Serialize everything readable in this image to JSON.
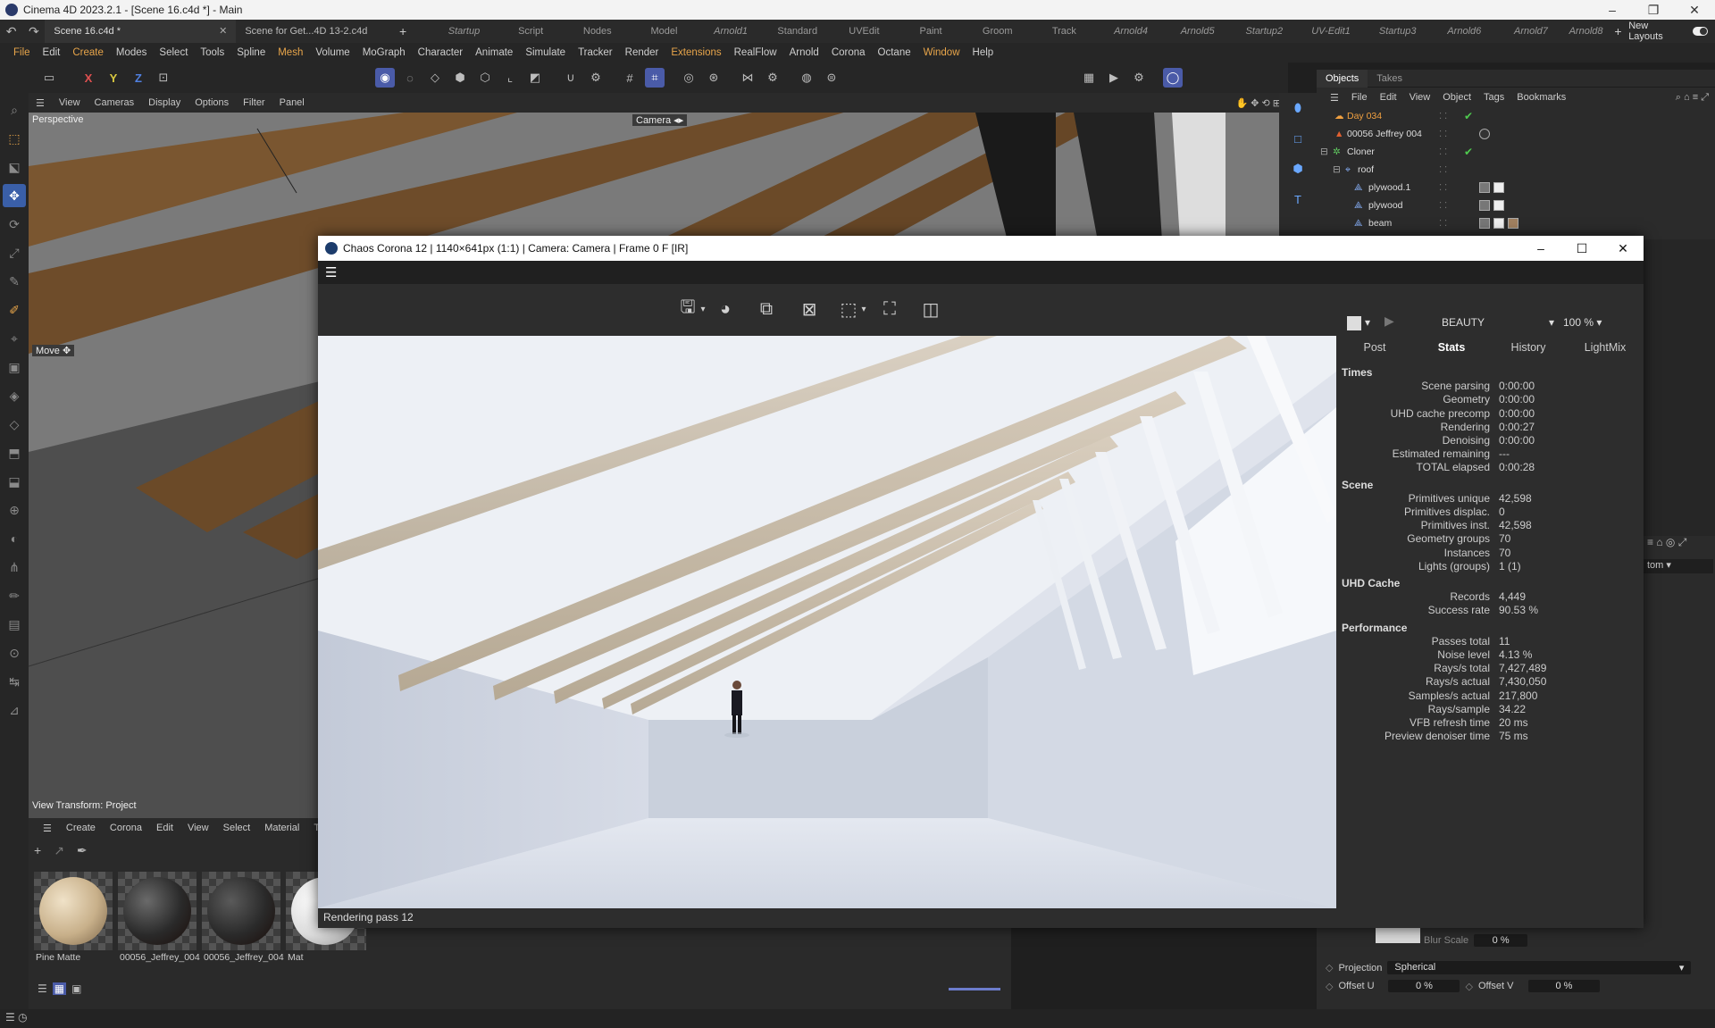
{
  "window": {
    "title": "Cinema 4D 2023.2.1 - [Scene 16.c4d *] - Main"
  },
  "tabs": {
    "active_doc": "Scene 16.c4d *",
    "second_doc": "Scene for Get...4D 13-2.c4d",
    "layouts": [
      "Startup",
      "Script",
      "Nodes",
      "Model",
      "Arnold1",
      "Standard",
      "UVEdit",
      "Paint",
      "Groom",
      "Track",
      "Arnold4",
      "Arnold5",
      "Startup2",
      "UV-Edit1",
      "Startup3",
      "Arnold6",
      "Arnold7",
      "Arnold8"
    ],
    "new_layouts": "New Layouts"
  },
  "menu": [
    "File",
    "Edit",
    "Create",
    "Modes",
    "Select",
    "Tools",
    "Spline",
    "Mesh",
    "Volume",
    "MoGraph",
    "Character",
    "Animate",
    "Simulate",
    "Tracker",
    "Render",
    "Extensions",
    "RealFlow",
    "Arnold",
    "Corona",
    "Octane",
    "Window",
    "Help"
  ],
  "toolbar": {
    "axis_x": "X",
    "axis_y": "Y",
    "axis_z": "Z"
  },
  "viewport": {
    "menu": [
      "View",
      "Cameras",
      "Display",
      "Options",
      "Filter",
      "Panel"
    ],
    "label": "Perspective",
    "camera": "Camera",
    "move_label": "Move",
    "view_transform": "View Transform: Project"
  },
  "objects": {
    "tabs": [
      "Objects",
      "Takes"
    ],
    "menu": [
      "File",
      "Edit",
      "View",
      "Object",
      "Tags",
      "Bookmarks"
    ],
    "rows": [
      {
        "name": "Day 034",
        "color": "#f0a040"
      },
      {
        "name": "00056 Jeffrey 004",
        "color": "#dddddd"
      },
      {
        "name": "Cloner",
        "color": "#dddddd"
      },
      {
        "name": "roof",
        "color": "#dddddd"
      },
      {
        "name": "plywood.1",
        "color": "#dddddd"
      },
      {
        "name": "plywood",
        "color": "#dddddd"
      },
      {
        "name": "beam",
        "color": "#dddddd"
      }
    ]
  },
  "materials": {
    "menu": [
      "Create",
      "Corona",
      "Edit",
      "View",
      "Select",
      "Material",
      "Texture"
    ],
    "items": [
      "Pine Matte",
      "00056_Jeffrey_004",
      "00056_Jeffrey_004",
      "Mat"
    ]
  },
  "attributes": {
    "blur_scale_label": "Blur Scale",
    "blur_scale_value": "0 %",
    "projection_label": "Projection",
    "projection_value": "Spherical",
    "offset_u_label": "Offset U",
    "offset_u_value": "0 %",
    "offset_v_label": "Offset V",
    "offset_v_value": "0 %",
    "dropdown_partial": "tom"
  },
  "corona": {
    "title": "Chaos Corona 12 | 1140×641px (1:1) | Camera: Camera | Frame 0 F [IR]",
    "pass_dropdown": "BEAUTY",
    "zoom": "100 %",
    "tabs": [
      "Post",
      "Stats",
      "History",
      "LightMix"
    ],
    "status": "Rendering pass 12",
    "sections": [
      {
        "title": "Times",
        "rows": [
          [
            "Scene parsing",
            "0:00:00"
          ],
          [
            "Geometry",
            "0:00:00"
          ],
          [
            "UHD cache precomp",
            "0:00:00"
          ],
          [
            "Rendering",
            "0:00:27"
          ],
          [
            "Denoising",
            "0:00:00"
          ],
          [
            "Estimated remaining",
            "---"
          ],
          [
            "TOTAL elapsed",
            "0:00:28"
          ]
        ]
      },
      {
        "title": "Scene",
        "rows": [
          [
            "Primitives unique",
            "42,598"
          ],
          [
            "Primitives displac.",
            "0"
          ],
          [
            "Primitives inst.",
            "42,598"
          ],
          [
            "Geometry groups",
            "70"
          ],
          [
            "Instances",
            "70"
          ],
          [
            "Lights (groups)",
            "1 (1)"
          ]
        ]
      },
      {
        "title": "UHD Cache",
        "rows": [
          [
            "Records",
            "4,449"
          ],
          [
            "Success rate",
            "90.53 %"
          ]
        ]
      },
      {
        "title": "Performance",
        "rows": [
          [
            "Passes total",
            "11"
          ],
          [
            "Noise level",
            "4.13 %"
          ],
          [
            "Rays/s total",
            "7,427,489"
          ],
          [
            "Rays/s actual",
            "7,430,050"
          ],
          [
            "Samples/s actual",
            "217,800"
          ],
          [
            "Rays/sample",
            "34.22"
          ],
          [
            "VFB refresh time",
            "20 ms"
          ],
          [
            "Preview denoiser time",
            "75 ms"
          ]
        ]
      }
    ]
  },
  "colors": {
    "accent": "#e8a54a",
    "active_tool": "#3a5fa8",
    "check": "#4ec94e"
  }
}
